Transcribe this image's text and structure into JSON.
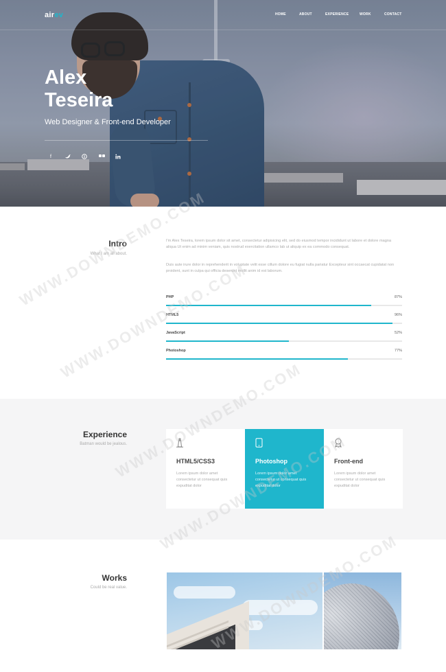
{
  "brand": {
    "logo_main": "air",
    "logo_accent": "ev"
  },
  "nav": {
    "items": [
      "HOME",
      "ABOUT",
      "EXPERIENCE",
      "WORK",
      "CONTACT"
    ]
  },
  "hero": {
    "name_line1": "Alex",
    "name_line2": "Teseira",
    "subtitle": "Web Designer & Front-end Developer",
    "social_icons": [
      "facebook-icon",
      "twitter-icon",
      "pinterest-icon",
      "flickr-icon",
      "linkedin-icon"
    ]
  },
  "intro": {
    "title": "Intro",
    "subtitle": "What I am all about.",
    "paragraph1": "I'm Alex Teseira, lorem ipsum dolor sit amet, consectetur adipisicing elit, sed do eiusmod tempor incididunt ut labore et dolore magna aliqua Ut enim ad minim veniam, quis nostrud exercitation ullamco lab ut aliquip ex ea commodo consequat.",
    "paragraph2": "Duis aute irure dolor in reprehenderit in voluptate velit esse cillum dolore eu fugiat nulla pariatur Excepteur sint occaecat cupidatat non proident, sunt in culpa qui officia deserunt mollit anim id est laborum.",
    "skills": [
      {
        "name": "PHP",
        "percent": "87%",
        "value": 87
      },
      {
        "name": "HTML5",
        "percent": "96%",
        "value": 96
      },
      {
        "name": "JavaScript",
        "percent": "52%",
        "value": 52
      },
      {
        "name": "Photoshop",
        "percent": "77%",
        "value": 77
      }
    ]
  },
  "experience": {
    "title": "Experience",
    "subtitle": "Batman would be jealous.",
    "cards": [
      {
        "title": "HTML5/CSS3",
        "desc": "Lorem ipsum dolor amet consectetur ut consequat quis expuditat dolor",
        "icon": "lighthouse-icon"
      },
      {
        "title": "Photoshop",
        "desc": "Lorem ipsum dolor amet consectetur ut consequat quis expuditat dolor",
        "icon": "tablet-icon"
      },
      {
        "title": "Front-end",
        "desc": "Lorem ipsum dolor amet consectetur ut consequat quis expuditat dolor",
        "icon": "award-icon"
      }
    ]
  },
  "works": {
    "title": "Works",
    "subtitle": "Could be real value."
  },
  "watermark": "WWW.DOWNDEMO.COM",
  "colors": {
    "accent": "#1fb6cc"
  }
}
